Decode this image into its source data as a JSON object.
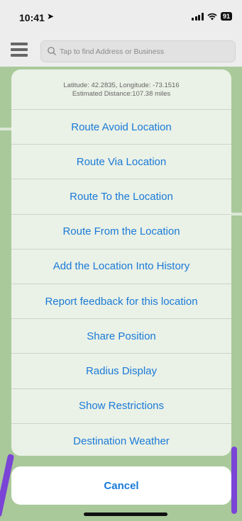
{
  "status_bar": {
    "time": "10:41",
    "battery": "91"
  },
  "search": {
    "placeholder": "Tap to find Address or Business"
  },
  "sheet": {
    "header_line1": "Latitude: 42.2835, Longitude: -73.1516",
    "header_line2": "Estimated Distance:107.38 miles",
    "items": [
      {
        "label": "Route Avoid Location"
      },
      {
        "label": "Route Via Location"
      },
      {
        "label": "Route To the Location"
      },
      {
        "label": "Route From the Location"
      },
      {
        "label": "Add the Location Into History"
      },
      {
        "label": "Report feedback for this location"
      },
      {
        "label": "Share Position"
      },
      {
        "label": "Radius Display"
      },
      {
        "label": "Show Restrictions"
      },
      {
        "label": "Destination Weather"
      }
    ],
    "cancel_label": "Cancel"
  },
  "colors": {
    "action_blue": "#1a7ad8",
    "route_purple": "#7a44d6",
    "map_green": "#a9c99a"
  }
}
